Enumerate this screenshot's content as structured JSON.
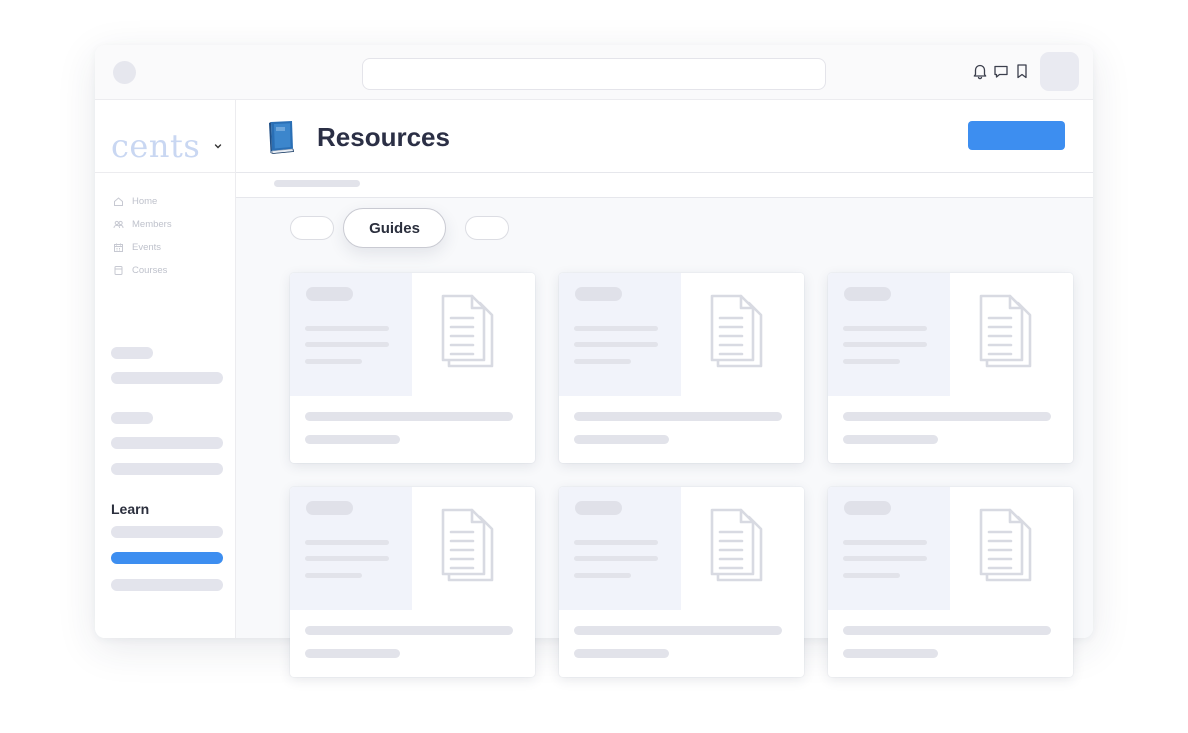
{
  "app": {
    "logo_text": "cents"
  },
  "topbar": {
    "icons": [
      "bell-icon",
      "chat-icon",
      "bookmark-icon"
    ]
  },
  "sidebar": {
    "nav": [
      {
        "label": "Home",
        "icon": "home-icon"
      },
      {
        "label": "Members",
        "icon": "members-icon"
      },
      {
        "label": "Events",
        "icon": "calendar-icon"
      },
      {
        "label": "Courses",
        "icon": "courses-icon"
      }
    ],
    "section_label": "Learn",
    "active_color": "#3d8ef0"
  },
  "header": {
    "title": "Resources",
    "icon": "blue-book-icon"
  },
  "tabs": {
    "active_label": "Guides"
  },
  "cards": {
    "count": 6,
    "icon": "document-icon"
  },
  "colors": {
    "accent": "#3d8ef0",
    "logo": "#c9d7f2"
  }
}
